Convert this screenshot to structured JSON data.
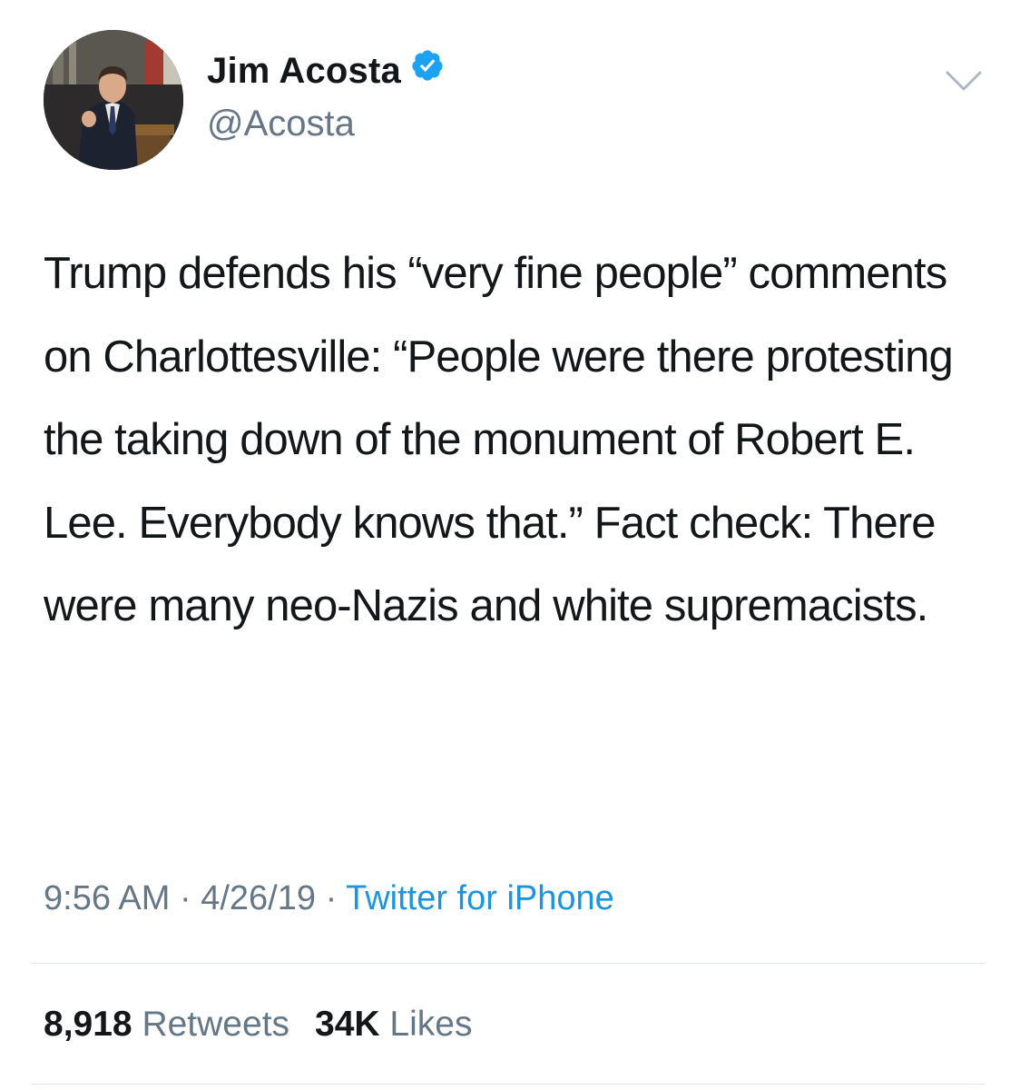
{
  "author": {
    "display_name": "Jim Acosta",
    "handle": "@Acosta",
    "verified": true,
    "avatar": "avatar-photo"
  },
  "tweet": {
    "text": "Trump defends his “very fine people” comments on Charlottesville: “People were there protesting the taking down of the monument of Robert E. Lee. Everybody knows that.”  Fact check: There were many neo-Nazis and white supremacists.",
    "time": "9:56 AM",
    "date": "4/26/19",
    "separator": "·",
    "source": "Twitter for iPhone"
  },
  "stats": {
    "retweets_count": "8,918",
    "retweets_label": "Retweets",
    "likes_count": "34K",
    "likes_label": "Likes"
  },
  "icons": {
    "verified": "verified-badge-icon",
    "menu": "chevron-down-icon"
  },
  "colors": {
    "text": "#14171a",
    "secondary": "#657786",
    "link": "#1b95e0",
    "verified": "#1da1f2",
    "divider": "#e1e8ed"
  }
}
